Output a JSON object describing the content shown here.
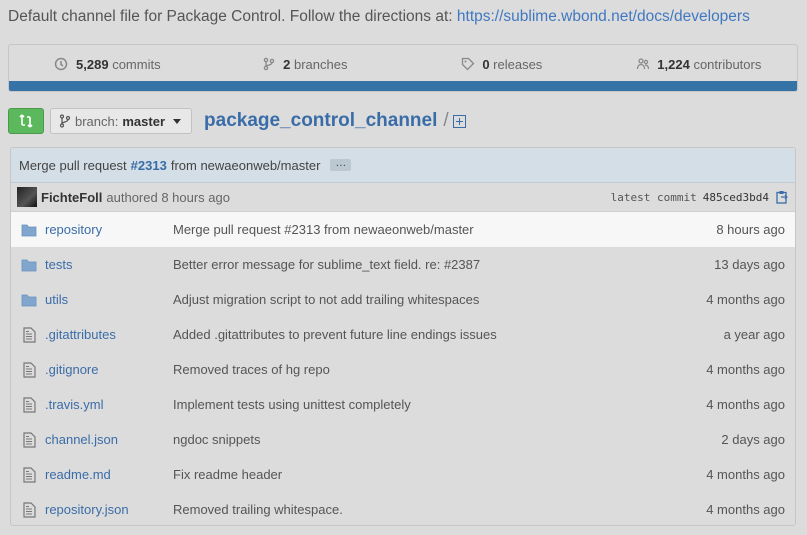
{
  "repo": {
    "description_text": "Default channel file for Package Control. Follow the directions at:",
    "description_link": "https://sublime.wbond.net/docs/developers",
    "name": "package_control_channel",
    "slash": "/"
  },
  "stats": [
    {
      "icon": "history-icon",
      "count": "5,289",
      "label": "commits"
    },
    {
      "icon": "branch-icon",
      "count": "2",
      "label": "branches"
    },
    {
      "icon": "tag-icon",
      "count": "0",
      "label": "releases"
    },
    {
      "icon": "contributors-icon",
      "count": "1,224",
      "label": "contributors"
    }
  ],
  "colors": {
    "language_bar": "#3572a5",
    "compare_button": "#5cb85c",
    "link": "#3a6da8"
  },
  "branch": {
    "prefix": "branch:",
    "name": "master"
  },
  "latest_commit": {
    "message_prefix": "Merge pull request",
    "pr_number": "#2313",
    "message_suffix": "from newaeonweb/master",
    "ellipsis": "…",
    "author": "FichteFoll",
    "authored": "authored 8 hours ago",
    "latest_label": "latest commit",
    "sha": "485ced3bd4"
  },
  "files": [
    {
      "type": "directory",
      "name": "repository",
      "message": "Merge pull request #2313 from newaeonweb/master",
      "age": "8 hours ago"
    },
    {
      "type": "directory",
      "name": "tests",
      "message": "Better error message for sublime_text field. re: #2387",
      "age": "13 days ago"
    },
    {
      "type": "directory",
      "name": "utils",
      "message": "Adjust migration script to not add trailing whitespaces",
      "age": "4 months ago"
    },
    {
      "type": "file",
      "name": ".gitattributes",
      "message": "Added .gitattributes to prevent future line endings issues",
      "age": "a year ago"
    },
    {
      "type": "file",
      "name": ".gitignore",
      "message": "Removed traces of hg repo",
      "age": "4 months ago"
    },
    {
      "type": "file",
      "name": ".travis.yml",
      "message": "Implement tests using unittest completely",
      "age": "4 months ago"
    },
    {
      "type": "file",
      "name": "channel.json",
      "message": "ngdoc snippets",
      "age": "2 days ago"
    },
    {
      "type": "file",
      "name": "readme.md",
      "message": "Fix readme header",
      "age": "4 months ago"
    },
    {
      "type": "file",
      "name": "repository.json",
      "message": "Removed trailing whitespace.",
      "age": "4 months ago"
    }
  ]
}
